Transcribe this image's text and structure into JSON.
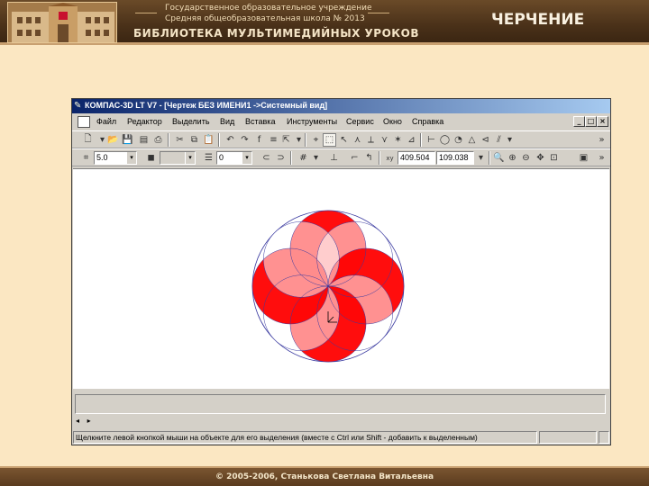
{
  "slide": {
    "header": {
      "institution_line1": "Государственное образовательное учреждение",
      "institution_line2": "Средняя общеобразовательная школа № 2013",
      "library_title": "БИБЛИОТЕКА МУЛЬТИМЕДИЙНЫХ УРОКОВ",
      "subject": "ЧЕРЧЕНИЕ"
    },
    "footer": {
      "copyright": "© 2005-2006, Станькова Светлана Витальевна"
    }
  },
  "window": {
    "title": "КОМПАС-3D LT V7 - [Чертеж БЕЗ ИМЕНИ1 ->Системный вид]",
    "menu": [
      "Файл",
      "Редактор",
      "Выделить",
      "Вид",
      "Вставка",
      "Инструменты",
      "Сервис",
      "Окно",
      "Справка"
    ],
    "mdi_controls": [
      "_",
      "□",
      "×"
    ],
    "params": {
      "line_step": "5.0",
      "layer": "0",
      "coord_x": "409.504",
      "coord_y": "109.038"
    },
    "status_text": "Щелкните левой кнопкой мыши на объекте для его выделения (вместе с Ctrl или Shift - добавить к выделенным)",
    "scroll_arrows": [
      "◂",
      "▸"
    ]
  },
  "colors": {
    "accent_red": "#ff0000",
    "outline_blue": "#3a3aa0",
    "titlebar_start": "#0a246a",
    "titlebar_end": "#a6caf0"
  }
}
